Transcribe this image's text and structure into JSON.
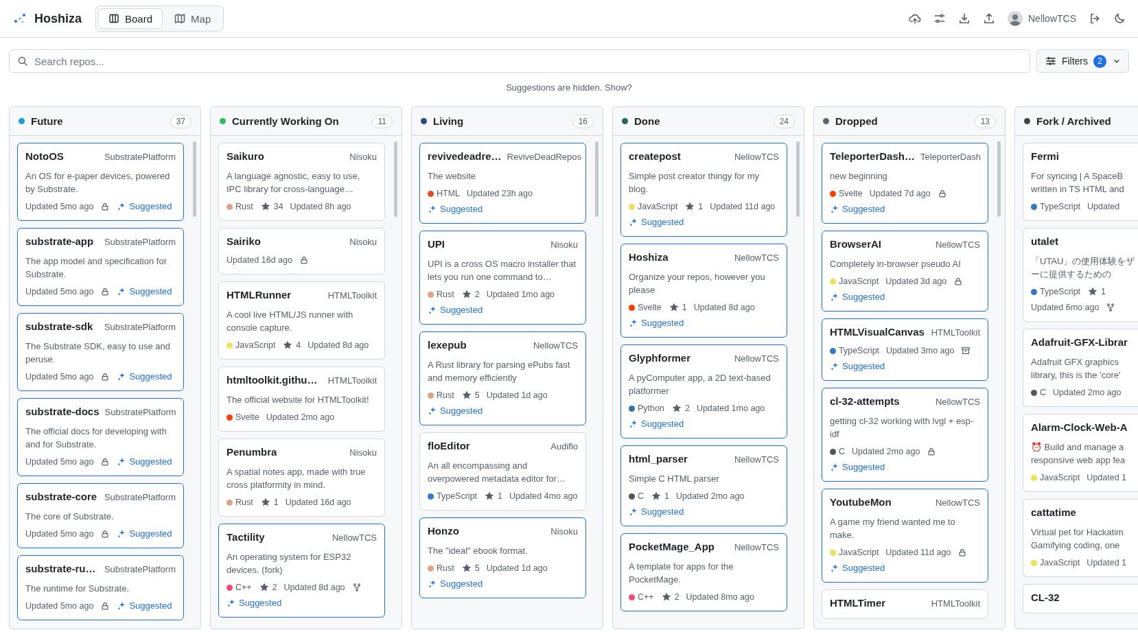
{
  "app": {
    "title": "Hoshiza"
  },
  "views": [
    {
      "label": "Board",
      "selected": true
    },
    {
      "label": "Map",
      "selected": false
    }
  ],
  "user": {
    "name": "NellowTCS"
  },
  "search": {
    "placeholder": "Search repos..."
  },
  "filters": {
    "label": "Filters",
    "count": "2"
  },
  "notice": {
    "text": "Suggestions are hidden.",
    "link": "Show?"
  },
  "columns": [
    {
      "title": "Future",
      "color": "#1a9fd9",
      "count": "37",
      "cards": [
        {
          "name": "NotoOS",
          "owner": "SubstratePlatform",
          "description": "An OS for e-paper devices, powered by Substrate.",
          "updated": "Updated 5mo ago",
          "private": true,
          "suggested": true,
          "tag": "Suggested"
        },
        {
          "name": "substrate-app",
          "owner": "SubstratePlatform",
          "description": "The app model and specification for Substrate.",
          "updated": "Updated 5mo ago",
          "private": true,
          "suggested": true,
          "tag": "Suggested"
        },
        {
          "name": "substrate-sdk",
          "owner": "SubstratePlatform",
          "description": "The Substrate SDK, easy to use and peruse.",
          "updated": "Updated 5mo ago",
          "private": true,
          "suggested": true,
          "tag": "Suggested"
        },
        {
          "name": "substrate-docs",
          "owner": "SubstratePlatform",
          "description": "The official docs for developing with and for Substrate.",
          "updated": "Updated 5mo ago",
          "private": true,
          "suggested": true,
          "tag": "Suggested"
        },
        {
          "name": "substrate-core",
          "owner": "SubstratePlatform",
          "description": "The core of Substrate.",
          "updated": "Updated 5mo ago",
          "private": true,
          "suggested": true,
          "tag": "Suggested"
        },
        {
          "name": "substrate-ru…",
          "owner": "SubstratePlatform",
          "description": "The runtime for Substrate.",
          "updated": "Updated 5mo ago",
          "private": true,
          "suggested": true,
          "tag": "Suggested"
        }
      ]
    },
    {
      "title": "Currently Working On",
      "color": "#2fbf5a",
      "count": "11",
      "cards": [
        {
          "name": "Saikuro",
          "owner": "Nisoku",
          "description": "A language agnostic, easy to use, IPC library for cross-language…",
          "language": {
            "name": "Rust",
            "color": "#dea584"
          },
          "star_count": "34",
          "updated": "Updated 8h ago",
          "suggested": false
        },
        {
          "name": "Sairiko",
          "owner": "Nisoku",
          "updated": "Updated 16d ago",
          "private": true,
          "suggested": false
        },
        {
          "name": "HTMLRunner",
          "owner": "HTMLToolkit",
          "description": "A cool live HTML/JS runner with console capture.",
          "language": {
            "name": "JavaScript",
            "color": "#f1e05a"
          },
          "star_count": "4",
          "updated": "Updated 8d ago",
          "suggested": false
        },
        {
          "name": "htmltoolkit.githu…",
          "owner": "HTMLToolkit",
          "description": "The official website for HTMLToolkit!",
          "language": {
            "name": "Svelte",
            "color": "#ff3e00"
          },
          "updated": "Updated 2mo ago",
          "suggested": false
        },
        {
          "name": "Penumbra",
          "owner": "Nisoku",
          "description": "A spatial notes app, made with true cross platformity in mind.",
          "language": {
            "name": "Rust",
            "color": "#dea584"
          },
          "star_count": "1",
          "updated": "Updated 16d ago",
          "suggested": false
        },
        {
          "name": "Tactility",
          "owner": "NellowTCS",
          "description": "An operating system for ESP32 devices. (fork)",
          "language": {
            "name": "C++",
            "color": "#f34b7d"
          },
          "star_count": "2",
          "updated": "Updated 8d ago",
          "fork": true,
          "suggested": true,
          "tag": "Suggested"
        }
      ]
    },
    {
      "title": "Living",
      "color": "#2c4a87",
      "count": "16",
      "cards": [
        {
          "name": "revivedeadre…",
          "owner": "ReviveDeadRepos",
          "description": "The website",
          "language": {
            "name": "HTML",
            "color": "#e34c26"
          },
          "updated": "Updated 23h ago",
          "suggested": true,
          "tag": "Suggested"
        },
        {
          "name": "UPI",
          "owner": "Nisoku",
          "description": "UPI is a cross OS macro installer that lets you run one command to…",
          "language": {
            "name": "Rust",
            "color": "#dea584"
          },
          "star_count": "2",
          "updated": "Updated 1mo ago",
          "suggested": true,
          "tag": "Suggested"
        },
        {
          "name": "lexepub",
          "owner": "NellowTCS",
          "description": "A Rust library for parsing ePubs fast and memory efficiently",
          "language": {
            "name": "Rust",
            "color": "#dea584"
          },
          "star_count": "5",
          "updated": "Updated 1d ago",
          "suggested": true,
          "tag": "Suggested"
        },
        {
          "name": "floEditor",
          "owner": "Audiflo",
          "description": "An all encompassing and overpowered metadata editor for…",
          "language": {
            "name": "TypeScript",
            "color": "#3178c6"
          },
          "star_count": "1",
          "updated": "Updated 4mo ago",
          "suggested": false
        },
        {
          "name": "Honzo",
          "owner": "Nisoku",
          "description": "The \"ideal\" ebook format.",
          "language": {
            "name": "Rust",
            "color": "#dea584"
          },
          "star_count": "5",
          "updated": "Updated 1d ago",
          "suggested": true,
          "tag": "Suggested"
        }
      ]
    },
    {
      "title": "Done",
      "color": "#2a6b4c",
      "count": "24",
      "cards": [
        {
          "name": "createpost",
          "owner": "NellowTCS",
          "description": "Simple post creator thingy for my blog.",
          "language": {
            "name": "JavaScript",
            "color": "#f1e05a"
          },
          "star_count": "1",
          "updated": "Updated 11d ago",
          "suggested": true,
          "tag": "Suggested"
        },
        {
          "name": "Hoshiza",
          "owner": "NellowTCS",
          "description": "Organize your repos, however you please",
          "language": {
            "name": "Svelte",
            "color": "#ff3e00"
          },
          "star_count": "1",
          "updated": "Updated 8d ago",
          "suggested": true,
          "tag": "Suggested"
        },
        {
          "name": "Glyphformer",
          "owner": "NellowTCS",
          "description": "A pyComputer app, a 2D text-based platformer",
          "language": {
            "name": "Python",
            "color": "#3572a5"
          },
          "star_count": "2",
          "updated": "Updated 1mo ago",
          "suggested": true,
          "tag": "Suggested"
        },
        {
          "name": "html_parser",
          "owner": "NellowTCS",
          "description": "Simple C HTML parser",
          "language": {
            "name": "C",
            "color": "#555555"
          },
          "star_count": "1",
          "updated": "Updated 2mo ago",
          "suggested": true,
          "tag": "Suggested"
        },
        {
          "name": "PocketMage_App",
          "owner": "NellowTCS",
          "description": "A template for apps for the PocketMage.",
          "language": {
            "name": "C++",
            "color": "#f34b7d"
          },
          "star_count": "2",
          "updated": "Updated 8mo ago",
          "suggested": true
        }
      ]
    },
    {
      "title": "Dropped",
      "color": "#666666",
      "count": "13",
      "cards": [
        {
          "name": "TeleporterDash…",
          "owner": "TeleporterDash",
          "description": "new beginning",
          "language": {
            "name": "Svelte",
            "color": "#ff3e00"
          },
          "updated": "Updated 7d ago",
          "private": true,
          "suggested": true,
          "tag": "Suggested"
        },
        {
          "name": "BrowserAI",
          "owner": "NellowTCS",
          "description": "Completely in-browser pseudo AI",
          "language": {
            "name": "JavaScript",
            "color": "#f1e05a"
          },
          "updated": "Updated 3d ago",
          "private": true,
          "suggested": true,
          "tag": "Suggested"
        },
        {
          "name": "HTMLVisualCanvas",
          "owner": "HTMLToolkit",
          "language": {
            "name": "TypeScript",
            "color": "#3178c6"
          },
          "updated": "Updated 3mo ago",
          "archived": true,
          "suggested": true,
          "tag": "Suggested"
        },
        {
          "name": "cl-32-attempts",
          "owner": "NellowTCS",
          "description": "getting cl-32 working with lvgl + esp-idf",
          "language": {
            "name": "C",
            "color": "#555555"
          },
          "updated": "Updated 2mo ago",
          "private": true,
          "suggested": true,
          "tag": "Suggested"
        },
        {
          "name": "YoutubeMon",
          "owner": "NellowTCS",
          "description": "A game my friend wanted me to make.",
          "language": {
            "name": "JavaScript",
            "color": "#f1e05a"
          },
          "updated": "Updated 11d ago",
          "private": true,
          "suggested": true,
          "tag": "Suggested"
        },
        {
          "name": "HTMLTimer",
          "owner": "HTMLToolkit",
          "suggested": false
        }
      ]
    },
    {
      "title": "Fork / Archived",
      "color": "#444444",
      "cards": [
        {
          "name": "Fermi",
          "description": "For syncing | A SpaceB\nwritten in TS HTML and",
          "language": {
            "name": "TypeScript",
            "color": "#3178c6"
          },
          "updated": "Updated",
          "suggested": false
        },
        {
          "name": "utalet",
          "description": "「UTAU」の使用体験をザーに提供するための",
          "language": {
            "name": "TypeScript",
            "color": "#3178c6"
          },
          "star_count": "1",
          "updated": "Updated 6mo ago",
          "fork": true,
          "suggested": false
        },
        {
          "name": "Adafruit-GFX-Librar",
          "description": "Adafruit GFX graphics\nlibrary, this is the 'core'",
          "language": {
            "name": "C",
            "color": "#555555"
          },
          "updated": "Updated 2mo ago",
          "suggested": false
        },
        {
          "name": "Alarm-Clock-Web-A",
          "description": "⏰ Build and manage a\nresponsive web app fea",
          "language": {
            "name": "JavaScript",
            "color": "#f1e05a"
          },
          "updated": "Updated 1",
          "suggested": false
        },
        {
          "name": "cattatime",
          "description": "Virtual pet for Hackatim\nGamifying coding, one",
          "language": {
            "name": "JavaScript",
            "color": "#f1e05a"
          },
          "updated": "Updated 1",
          "suggested": false
        },
        {
          "name": "CL-32",
          "suggested": false
        }
      ]
    }
  ]
}
